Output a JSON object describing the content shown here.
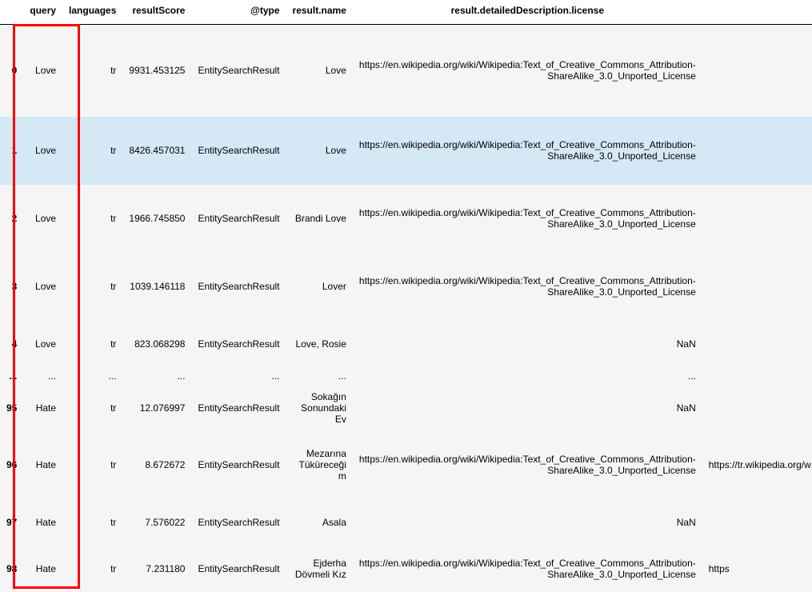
{
  "columns": {
    "index": "",
    "query": "query",
    "languages": "languages",
    "resultScore": "resultScore",
    "type": "@type",
    "resultName": "result.name",
    "license": "result.detailedDescription.license",
    "extra": ""
  },
  "rows": [
    {
      "index": "0",
      "query": "Love",
      "languages": "tr",
      "resultScore": "9931.453125",
      "type": "EntitySearchResult",
      "name": "Love",
      "license": "https://en.wikipedia.org/wiki/Wikipedia:Text_of_Creative_Commons_Attribution-ShareAlike_3.0_Unported_License",
      "extra": "",
      "height": "tall",
      "highlight": false
    },
    {
      "index": "1",
      "query": "Love",
      "languages": "tr",
      "resultScore": "8426.457031",
      "type": "EntitySearchResult",
      "name": "Love",
      "license": "https://en.wikipedia.org/wiki/Wikipedia:Text_of_Creative_Commons_Attribution-ShareAlike_3.0_Unported_License",
      "extra": "",
      "height": "med",
      "highlight": true
    },
    {
      "index": "2",
      "query": "Love",
      "languages": "tr",
      "resultScore": "1966.745850",
      "type": "EntitySearchResult",
      "name": "Brandi Love",
      "license": "https://en.wikipedia.org/wiki/Wikipedia:Text_of_Creative_Commons_Attribution-ShareAlike_3.0_Unported_License",
      "extra": "",
      "height": "med",
      "highlight": false
    },
    {
      "index": "3",
      "query": "Love",
      "languages": "tr",
      "resultScore": "1039.146118",
      "type": "EntitySearchResult",
      "name": "Lover",
      "license": "https://en.wikipedia.org/wiki/Wikipedia:Text_of_Creative_Commons_Attribution-ShareAlike_3.0_Unported_License",
      "extra": "",
      "height": "med",
      "highlight": false
    },
    {
      "index": "4",
      "query": "Love",
      "languages": "tr",
      "resultScore": "823.068298",
      "type": "EntitySearchResult",
      "name": "Love, Rosie",
      "license": "NaN",
      "extra": "",
      "height": "short",
      "highlight": false
    },
    {
      "index": "...",
      "query": "...",
      "languages": "...",
      "resultScore": "...",
      "type": "...",
      "name": "...",
      "license": "...",
      "extra": "",
      "height": "",
      "highlight": false,
      "ellipsis": true
    },
    {
      "index": "95",
      "query": "Hate",
      "languages": "tr",
      "resultScore": "12.076997",
      "type": "EntitySearchResult",
      "name": "Sokağın Sonundaki Ev",
      "license": "NaN",
      "extra": "",
      "height": "short",
      "highlight": false
    },
    {
      "index": "96",
      "query": "Hate",
      "languages": "tr",
      "resultScore": "8.672672",
      "type": "EntitySearchResult",
      "name": "Mezarına Tüküreceğim",
      "license": "https://en.wikipedia.org/wiki/Wikipedia:Text_of_Creative_Commons_Attribution-ShareAlike_3.0_Unported_License",
      "extra": "https://tr.wikipedia.org/w",
      "height": "med",
      "highlight": false
    },
    {
      "index": "97",
      "query": "Hate",
      "languages": "tr",
      "resultScore": "7.576022",
      "type": "EntitySearchResult",
      "name": "Asala",
      "license": "NaN",
      "extra": "",
      "height": "short",
      "highlight": false
    },
    {
      "index": "98",
      "query": "Hate",
      "languages": "tr",
      "resultScore": "7.231180",
      "type": "EntitySearchResult",
      "name": "Ejderha Dövmeli Kız",
      "license": "https://en.wikipedia.org/wiki/Wikipedia:Text_of_Creative_Commons_Attribution-ShareAlike_3.0_Unported_License",
      "extra": "https",
      "height": "short",
      "highlight": false
    }
  ]
}
